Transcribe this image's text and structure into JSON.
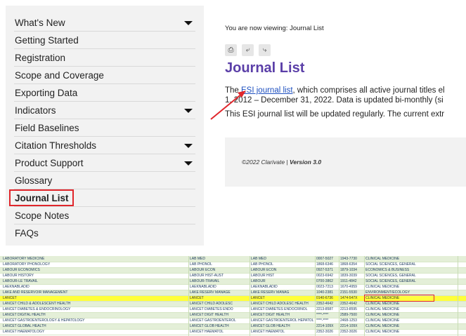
{
  "sidebar": {
    "items": [
      {
        "label": "What's New",
        "has_dropdown": true
      },
      {
        "label": "Getting Started",
        "has_dropdown": false
      },
      {
        "label": "Registration",
        "has_dropdown": false
      },
      {
        "label": "Scope and Coverage",
        "has_dropdown": false
      },
      {
        "label": "Exporting Data",
        "has_dropdown": false
      },
      {
        "label": "Indicators",
        "has_dropdown": true
      },
      {
        "label": "Field Baselines",
        "has_dropdown": false
      },
      {
        "label": "Citation Thresholds",
        "has_dropdown": true
      },
      {
        "label": "Product Support",
        "has_dropdown": true
      },
      {
        "label": "Glossary",
        "has_dropdown": false
      },
      {
        "label": "Journal List",
        "has_dropdown": false,
        "active": true
      },
      {
        "label": "Scope Notes",
        "has_dropdown": false
      },
      {
        "label": "FAQs",
        "has_dropdown": false
      }
    ]
  },
  "main": {
    "viewing_text": "You are now viewing: Journal List",
    "toolbar": {
      "print_icon": "print-icon",
      "back_icon": "back-arrow-icon",
      "forward_icon": "forward-arrow-icon"
    },
    "heading": "Journal List",
    "para1_before": "The ",
    "para1_link": "ESI journal list",
    "para1_after": ", which comprises all active journal titles el",
    "para1_line2": "1, 2012 – December 31, 2022. Data is updated bi-monthly (si",
    "para2": "This ESI journal list will be updated regularly. The current extr",
    "footer": {
      "copyright": "©2022 Clarivate | ",
      "version": "Version 3.0"
    }
  },
  "colors": {
    "accent": "#5b3fa8",
    "link": "#1d4fbf",
    "highlight_box": "#e0262b",
    "row_highlight": "#ffff3a"
  },
  "sheet": {
    "rows": [
      [
        "LABORATORY MEDICINE",
        "LAB MED",
        "LAB MED",
        "0007-5027",
        "1943-7730",
        "CLINICAL MEDICINE"
      ],
      [
        "LABORATORY PHONOLOGY",
        "LAB PHONOL",
        "LAB PHONOL",
        "1868-6346",
        "1868-6354",
        "SOCIAL SCIENCES, GENERAL"
      ],
      [
        "LABOUR ECONOMICS",
        "LABOUR ECON",
        "LABOUR ECON",
        "0927-5371",
        "1879-1034",
        "ECONOMICS & BUSINESS"
      ],
      [
        "LABOUR HISTORY",
        "LABOUR HIST-AUST",
        "LABOUR HIST",
        "0023-6942",
        "1839-3039",
        "SOCIAL SCIENCES, GENERAL"
      ],
      [
        "LABOUR-LE TRAVAIL",
        "LABOUR-TRAVAIL",
        "LABOUR",
        "0700-3862",
        "1911-4842",
        "SOCIAL SCIENCES, GENERAL"
      ],
      [
        "LAEKNABLADID",
        "LAEKNABLADID",
        "LAEKNABLADID",
        "0023-7213",
        "1670-4959",
        "CLINICAL MEDICINE"
      ],
      [
        "LAKE AND RESERVOIR MANAGEMENT",
        "LAKE RESERV MANAGE",
        "LAKE RESERV MANAG",
        "1040-2381",
        "2151-5530",
        "ENVIRONMENT/ECOLOGY"
      ],
      [
        "LANCET",
        "LANCET",
        "LANCET",
        "0140-6736",
        "1474-547X",
        "CLINICAL MEDICINE"
      ],
      [
        "LANCET CHILD & ADOLESCENT HEALTH",
        "LANCET CHILD ADOLESC",
        "LANCET CHILD ADOLESC HEALTH",
        "2352-4642",
        "2352-4642",
        "CLINICAL MEDICINE"
      ],
      [
        "LANCET DIABETES & ENDOCRINOLOGY",
        "LANCET DIABETES ENDO",
        "LANCET DIABETES ENDOCRINOL",
        "2213-8587",
        "2213-8595",
        "CLINICAL MEDICINE"
      ],
      [
        "LANCET DIGITAL HEALTH",
        "LANCET DIGIT HEALTH",
        "LANCET DIGIT HEALTH",
        "****-****",
        "2589-7500",
        "CLINICAL MEDICINE"
      ],
      [
        "LANCET GASTROENTEROLOGY & HEPATOLOGY",
        "LANCET GASTROENTEROL",
        "LANCET GASTROENTEROL HEPATOL",
        "****-****",
        "2468-1253",
        "CLINICAL MEDICINE"
      ],
      [
        "LANCET GLOBAL HEALTH",
        "LANCET GLOB HEALTH",
        "LANCET GLOB HEALTH",
        "2214-109X",
        "2214-109X",
        "CLINICAL MEDICINE"
      ],
      [
        "LANCET HAEMATOLOGY",
        "LANCET HAEMATOL",
        "LANCET HAEMATOL",
        "2352-3026",
        "2352-3026",
        "CLINICAL MEDICINE"
      ]
    ]
  }
}
